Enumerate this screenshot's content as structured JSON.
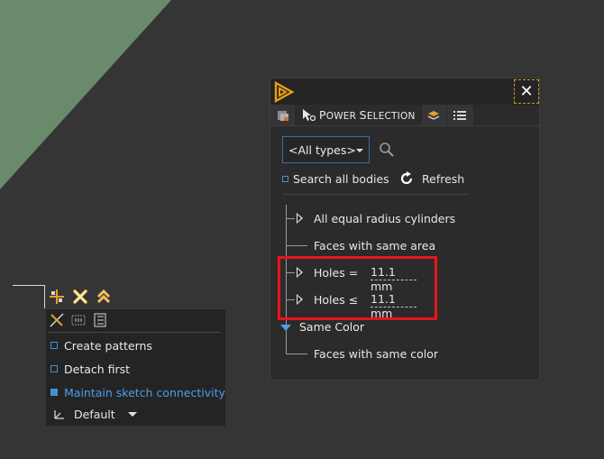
{
  "viewport_shape_color": "#6a8a6c",
  "mini_toolbar": {
    "options": [
      {
        "label": "Create patterns",
        "checked": false,
        "active": false
      },
      {
        "label": "Detach first",
        "checked": false,
        "active": false
      },
      {
        "label": "Maintain sketch connectivity",
        "checked": true,
        "active": true
      }
    ],
    "default_label": "Default"
  },
  "power_selection": {
    "tab_label_first": "P",
    "tab_label_rest_1": "ower ",
    "tab_label_s": "S",
    "tab_label_rest_2": "election",
    "type_select_value": "<All types>",
    "search_all_bodies": "Search all bodies",
    "refresh_label": "Refresh",
    "tree": {
      "equal_radius": "All equal radius cylinders",
      "same_area": "Faces with same area",
      "holes_eq": "Holes =",
      "holes_eq_value": "11.1 mm",
      "holes_le": "Holes ≤",
      "holes_le_value": "11.1 mm",
      "same_color": "Same Color",
      "same_color_faces": "Faces with same color"
    }
  },
  "colors": {
    "accent_blue": "#4a9fe8",
    "highlight_red": "#e8141b",
    "close_border": "#d99a20"
  }
}
